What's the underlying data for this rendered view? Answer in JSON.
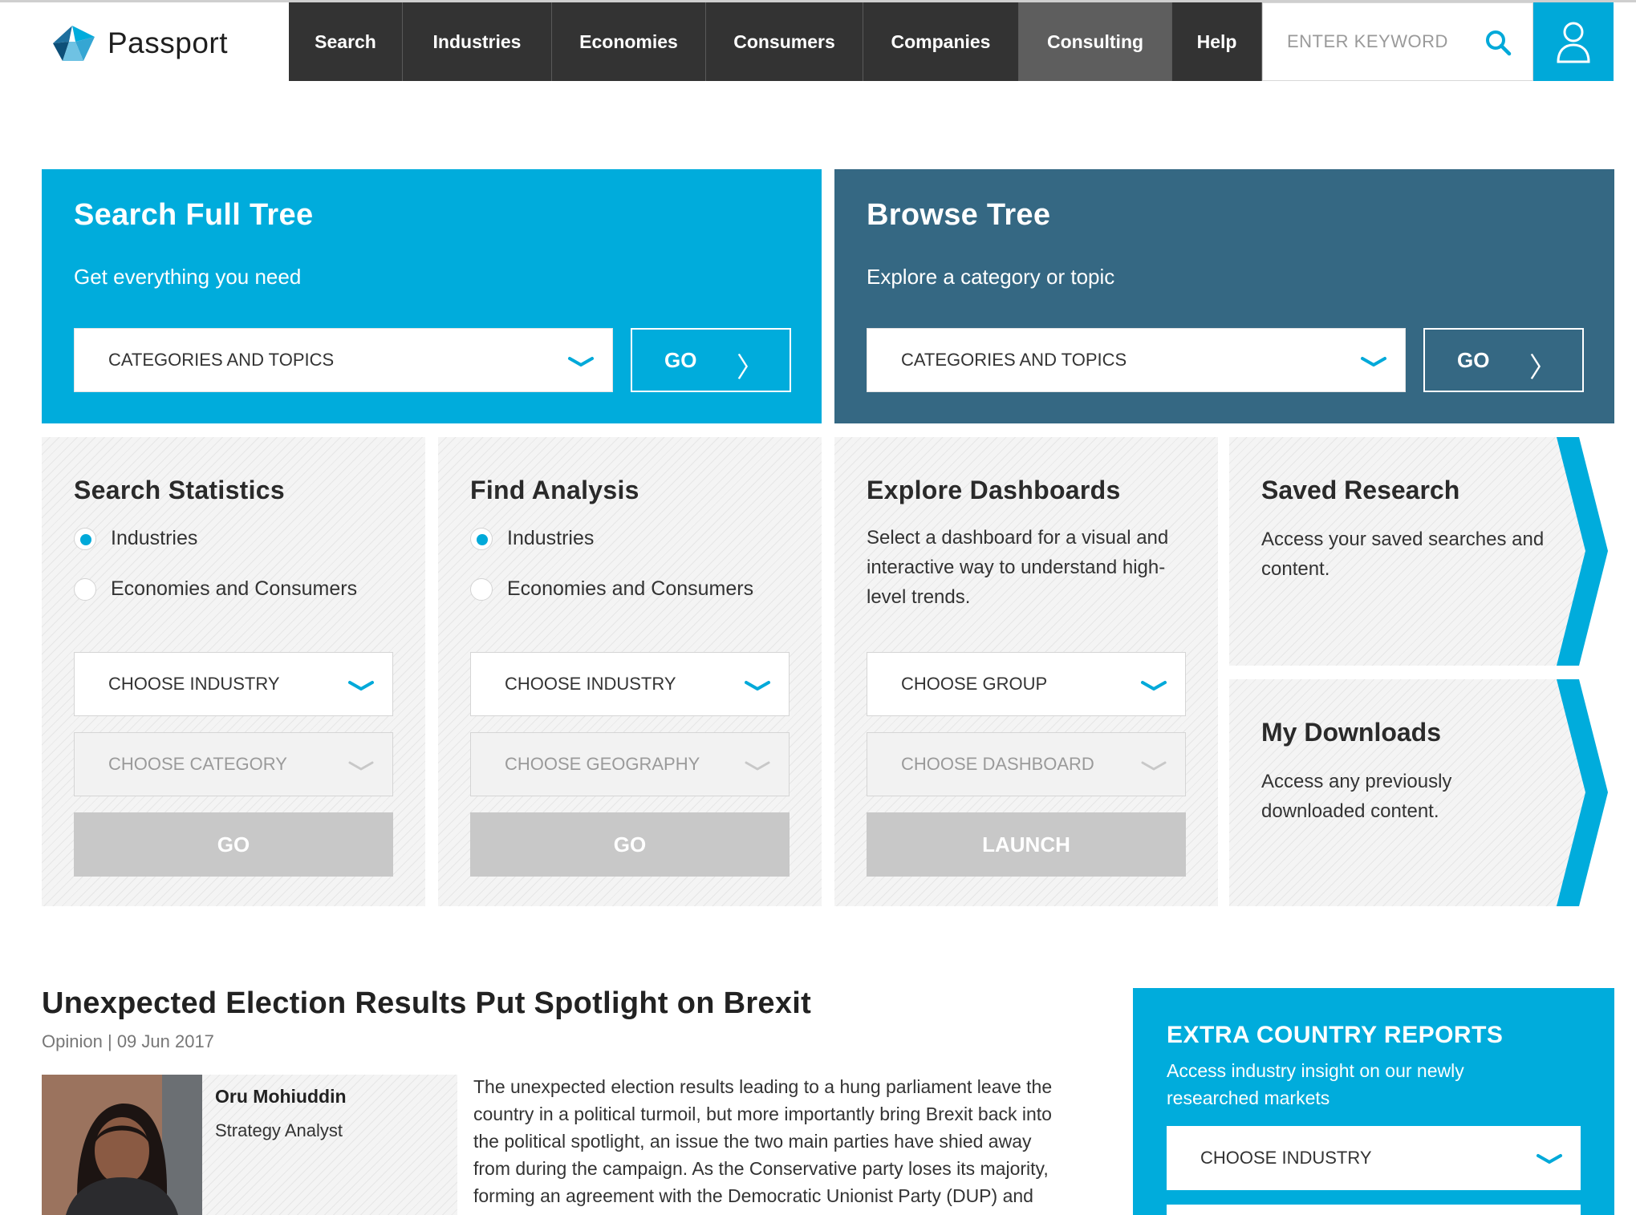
{
  "header": {
    "brand": "Passport",
    "nav": [
      {
        "label": "Search"
      },
      {
        "label": "Industries"
      },
      {
        "label": "Economies"
      },
      {
        "label": "Consumers"
      },
      {
        "label": "Companies"
      },
      {
        "label": "Consulting",
        "active": true
      },
      {
        "label": "Help"
      }
    ],
    "search_placeholder": "ENTER KEYWORD",
    "search_icon": "search-icon",
    "user_icon": "user-icon"
  },
  "colors": {
    "accent": "#00acdc",
    "browse_panel": "#356883",
    "nav_bg": "#333333",
    "nav_active": "#5e5e5e",
    "disabled_button": "#c8c8c8"
  },
  "search_full_tree": {
    "title": "Search Full Tree",
    "subtitle": "Get everything you need",
    "select_value": "CATEGORIES AND TOPICS",
    "go_label": "GO",
    "go_arrow": "〉"
  },
  "browse_tree": {
    "title": "Browse Tree",
    "subtitle": "Explore a category or topic",
    "select_value": "CATEGORIES AND TOPICS",
    "go_label": "GO",
    "go_arrow": "〉"
  },
  "search_statistics": {
    "title": "Search Statistics",
    "radio_1": "Industries",
    "radio_2": "Economies and Consumers",
    "selected": "Industries",
    "dropdown_1": "CHOOSE INDUSTRY",
    "dropdown_2": "CHOOSE CATEGORY",
    "action": "GO"
  },
  "find_analysis": {
    "title": "Find Analysis",
    "radio_1": "Industries",
    "radio_2": "Economies and Consumers",
    "selected": "Industries",
    "dropdown_1": "CHOOSE INDUSTRY",
    "dropdown_2": "CHOOSE GEOGRAPHY",
    "action": "GO"
  },
  "explore_dashboards": {
    "title": "Explore Dashboards",
    "description": "Select a dashboard for a visual and interactive way to understand high-level trends.",
    "dropdown_1": "CHOOSE GROUP",
    "dropdown_2": "CHOOSE DASHBOARD",
    "action": "LAUNCH"
  },
  "saved_research": {
    "title": "Saved Research",
    "description": "Access your saved searches and content."
  },
  "my_downloads": {
    "title": "My Downloads",
    "description": "Access any previously downloaded content."
  },
  "article": {
    "headline": "Unexpected Election Results Put Spotlight on Brexit",
    "category": "Opinion",
    "separator": "|",
    "date": "09 Jun 2017",
    "author_name": "Oru Mohiuddin",
    "author_role": "Strategy Analyst",
    "body": "The unexpected election results leading to a hung parliament leave the country in a political turmoil, but more importantly bring Brexit back into the political spotlight, an issue the two main parties have shied away from during the campaign. As the Conservative party loses its majority, forming an agreement with the Democratic Unionist Party (DUP) and with a narrow"
  },
  "extra_reports": {
    "title": "EXTRA COUNTRY REPORTS",
    "text": "Access industry insight on our newly researched markets",
    "dropdown": "CHOOSE INDUSTRY"
  }
}
